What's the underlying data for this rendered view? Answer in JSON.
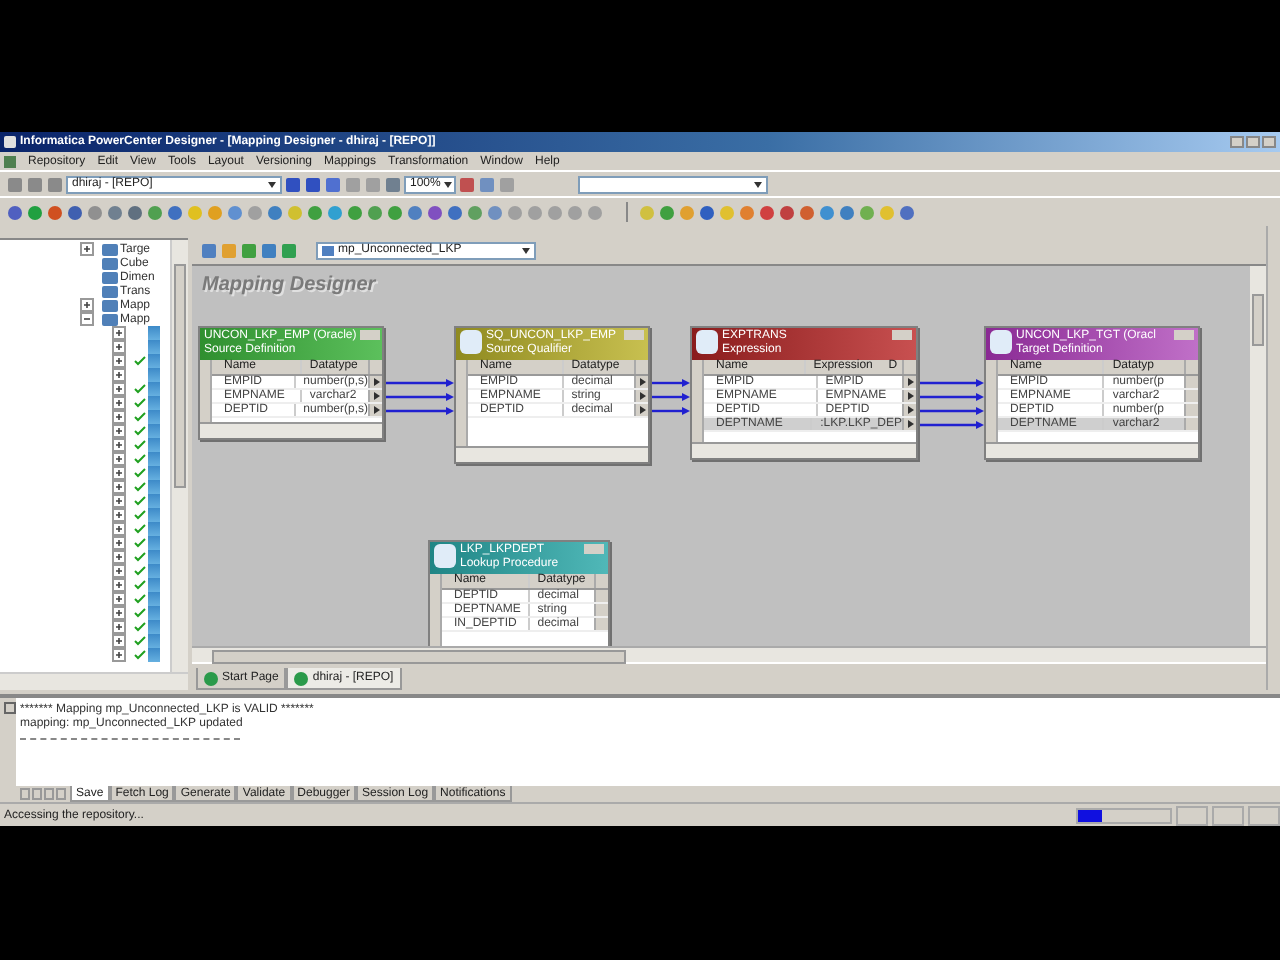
{
  "window": {
    "title": "Informatica PowerCenter Designer - [Mapping Designer - dhiraj - [REPO]]"
  },
  "menu": [
    "Repository",
    "Edit",
    "View",
    "Tools",
    "Layout",
    "Versioning",
    "Mappings",
    "Transformation",
    "Window",
    "Help"
  ],
  "toolbar": {
    "folder": "dhiraj - [REPO]",
    "zoom": "100%"
  },
  "navigator": {
    "items": [
      {
        "label": "Targe",
        "kind": "collapsed"
      },
      {
        "label": "Cube",
        "kind": "leaf"
      },
      {
        "label": "Dimen",
        "kind": "leaf"
      },
      {
        "label": "Trans",
        "kind": "leaf"
      },
      {
        "label": "Mapp",
        "kind": "collapsed"
      },
      {
        "label": "Mapp",
        "kind": "expanded",
        "children": [
          {
            "checked": false
          },
          {
            "checked": false
          },
          {
            "checked": true
          },
          {
            "checked": false
          },
          {
            "checked": true
          },
          {
            "checked": true
          },
          {
            "checked": true
          },
          {
            "checked": true
          },
          {
            "checked": true
          },
          {
            "checked": true
          },
          {
            "checked": true
          },
          {
            "checked": true
          },
          {
            "checked": true
          },
          {
            "checked": true
          },
          {
            "checked": true
          },
          {
            "checked": true
          },
          {
            "checked": true
          },
          {
            "checked": true
          },
          {
            "checked": true
          },
          {
            "checked": true
          },
          {
            "checked": true
          },
          {
            "checked": true
          },
          {
            "checked": true
          },
          {
            "checked": true
          }
        ]
      }
    ]
  },
  "workspace": {
    "mapping": "mp_Unconnected_LKP",
    "title": "Mapping Designer",
    "transformations": [
      {
        "kind": "source",
        "name": "UNCON_LKP_EMP (Oracle)",
        "type": "Source Definition",
        "columns": [
          "Name",
          "Datatype"
        ],
        "rows": [
          {
            "cells": [
              "EMPID",
              "number(p,s)"
            ],
            "selected": false,
            "linked_out": true
          },
          {
            "cells": [
              "EMPNAME",
              "varchar2"
            ],
            "selected": false,
            "linked_out": true
          },
          {
            "cells": [
              "DEPTID",
              "number(p,s)"
            ],
            "selected": false,
            "linked_out": true
          }
        ]
      },
      {
        "kind": "source_qualifier",
        "name": "SQ_UNCON_LKP_EMP",
        "type": "Source Qualifier",
        "columns": [
          "Name",
          "Datatype"
        ],
        "rows": [
          {
            "cells": [
              "EMPID",
              "decimal"
            ],
            "selected": false,
            "linked_out": true
          },
          {
            "cells": [
              "EMPNAME",
              "string"
            ],
            "selected": false,
            "linked_out": true
          },
          {
            "cells": [
              "DEPTID",
              "decimal"
            ],
            "selected": false,
            "linked_out": true
          }
        ]
      },
      {
        "kind": "expression",
        "name": "EXPTRANS",
        "type": "Expression",
        "columns": [
          "Name",
          "Expression",
          "D"
        ],
        "rows": [
          {
            "cells": [
              "EMPID",
              "EMPID"
            ],
            "selected": false,
            "linked_out": true
          },
          {
            "cells": [
              "EMPNAME",
              "EMPNAME"
            ],
            "selected": false,
            "linked_out": true
          },
          {
            "cells": [
              "DEPTID",
              "DEPTID"
            ],
            "selected": false,
            "linked_out": true
          },
          {
            "cells": [
              "DEPTNAME",
              ":LKP.LKP_DEP"
            ],
            "selected": true,
            "linked_out": true
          }
        ]
      },
      {
        "kind": "target",
        "name": "UNCON_LKP_TGT (Oracl",
        "type": "Target Definition",
        "columns": [
          "Name",
          "Datatyp"
        ],
        "rows": [
          {
            "cells": [
              "EMPID",
              "number(p"
            ],
            "selected": false,
            "linked_out": false
          },
          {
            "cells": [
              "EMPNAME",
              "varchar2"
            ],
            "selected": false,
            "linked_out": false
          },
          {
            "cells": [
              "DEPTID",
              "number(p"
            ],
            "selected": false,
            "linked_out": false
          },
          {
            "cells": [
              "DEPTNAME",
              "varchar2"
            ],
            "selected": true,
            "linked_out": false
          }
        ]
      },
      {
        "kind": "lookup",
        "name": "LKP_LKPDEPT",
        "type": "Lookup Procedure",
        "columns": [
          "Name",
          "Datatype"
        ],
        "rows": [
          {
            "cells": [
              "DEPTID",
              "decimal"
            ],
            "selected": false,
            "linked_out": false
          },
          {
            "cells": [
              "DEPTNAME",
              "string"
            ],
            "selected": false,
            "linked_out": false
          },
          {
            "cells": [
              "IN_DEPTID",
              "decimal"
            ],
            "selected": false,
            "linked_out": false
          }
        ]
      }
    ],
    "tabs": [
      {
        "label": "Start Page",
        "selected": false
      },
      {
        "label": "dhiraj - [REPO]",
        "selected": true
      }
    ]
  },
  "output": {
    "lines": [
      "******* Mapping mp_Unconnected_LKP is VALID *******",
      "mapping: mp_Unconnected_LKP updated"
    ],
    "tabs": [
      {
        "label": "Save",
        "selected": true
      },
      {
        "label": "Fetch Log",
        "selected": false
      },
      {
        "label": "Generate",
        "selected": false
      },
      {
        "label": "Validate",
        "selected": false
      },
      {
        "label": "Debugger",
        "selected": false
      },
      {
        "label": "Session Log",
        "selected": false
      },
      {
        "label": "Notifications",
        "selected": false
      }
    ]
  },
  "status_bar": {
    "text": "Accessing the repository...",
    "progress": {
      "level": 0.25
    }
  }
}
